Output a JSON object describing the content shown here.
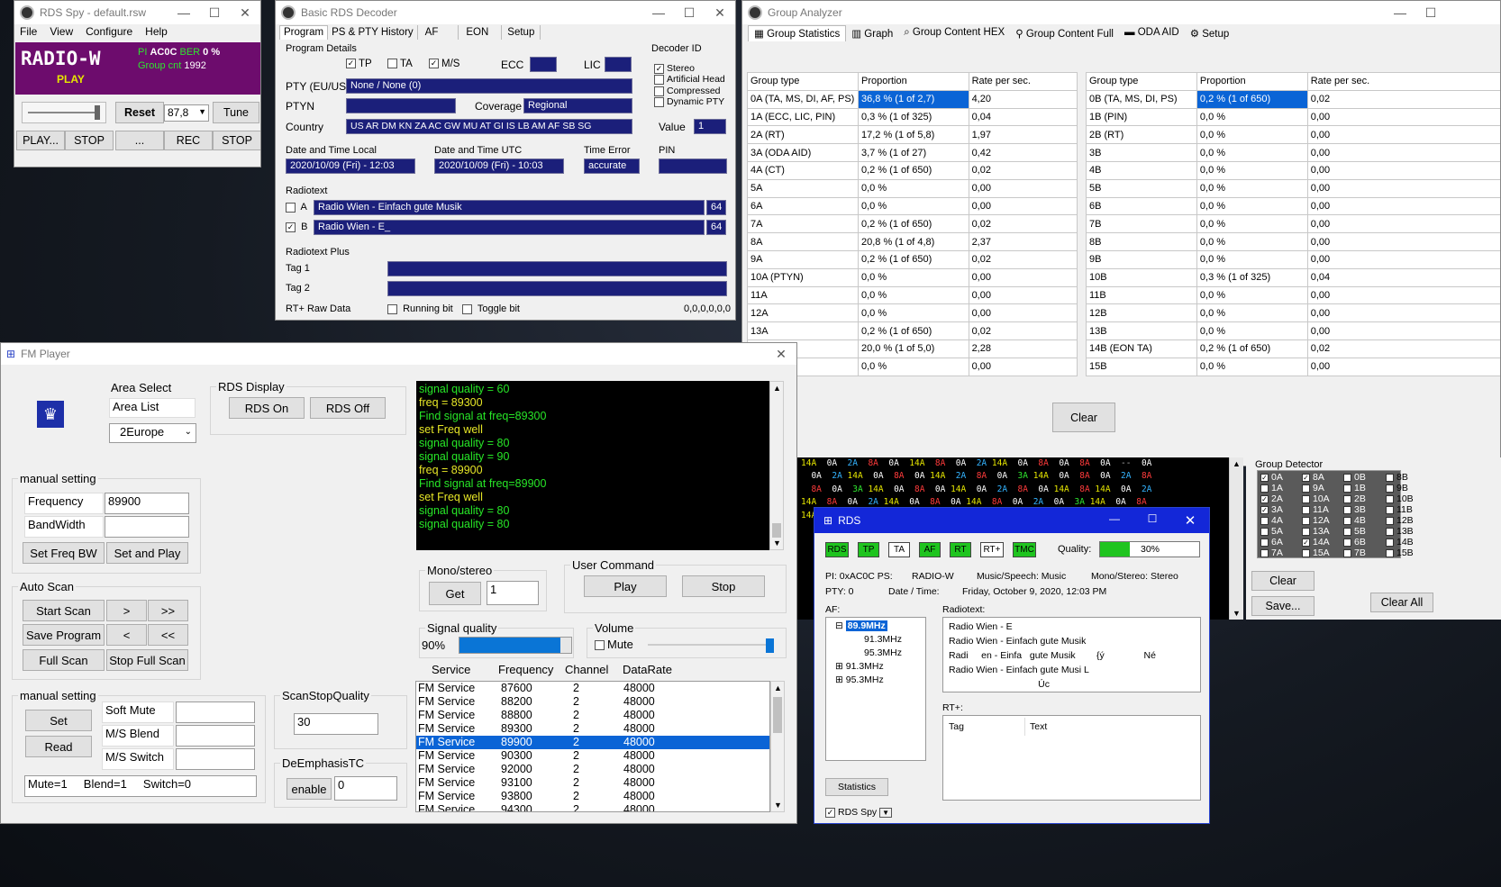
{
  "rds_spy": {
    "title": "RDS Spy - default.rsw",
    "menu": [
      "File",
      "View",
      "Configure",
      "Help"
    ],
    "station": "RADIO-W",
    "pi_label": "PI",
    "pi": "AC0C",
    "ber_label": "BER",
    "ber": "0 %",
    "group_cnt_label": "Group cnt",
    "group_cnt": "1992",
    "status": "PLAY",
    "reset": "Reset",
    "freq": "87,8",
    "tune": "Tune",
    "btns": [
      "PLAY...",
      "STOP",
      "...",
      "REC",
      "STOP"
    ]
  },
  "decoder": {
    "title": "Basic RDS Decoder",
    "tabs": [
      "Program",
      "PS & PTY History",
      "AF",
      "EON",
      "Setup"
    ],
    "program_details": "Program Details",
    "tp": "TP",
    "ta": "TA",
    "ms": "M/S",
    "ecc": "ECC",
    "lic": "LIC",
    "decoder_id": "Decoder ID",
    "stereo": "Stereo",
    "artificial_head": "Artificial Head",
    "compressed": "Compressed",
    "dynamic_pty": "Dynamic PTY",
    "value_label": "Value",
    "value": "1",
    "pty_label": "PTY (EU/US)",
    "pty": "None / None (0)",
    "ptyn_label": "PTYN",
    "coverage_label": "Coverage",
    "coverage": "Regional",
    "country_label": "Country",
    "country": "US AR DM KN ZA AC GW MU AT GI IS LB AM AF SB SG",
    "dt_local_label": "Date and Time Local",
    "dt_local": "2020/10/09 (Fri) - 12:03",
    "dt_utc_label": "Date and Time UTC",
    "dt_utc": "2020/10/09 (Fri) - 10:03",
    "time_error_label": "Time Error",
    "time_error": "accurate",
    "pin_label": "PIN",
    "radiotext_label": "Radiotext",
    "rt_a_label": "A",
    "rt_a": "Radio Wien - Einfach gute Musik",
    "rt_a_len": "64",
    "rt_b_label": "B",
    "rt_b": "Radio Wien - E_",
    "rt_b_len": "64",
    "rtplus_label": "Radiotext Plus",
    "tag1": "Tag 1",
    "tag2": "Tag 2",
    "rtplus_raw": "RT+ Raw Data",
    "running_bit": "Running bit",
    "toggle_bit": "Toggle bit",
    "raw_value": "0,0,0,0,0,0"
  },
  "analyzer": {
    "title": "Group Analyzer",
    "tabs": [
      "Group Statistics",
      "Graph",
      "Group Content HEX",
      "Group Content Full",
      "ODA AID",
      "Setup"
    ],
    "headers": [
      "Group type",
      "Proportion",
      "Rate per sec."
    ],
    "rows_a": [
      [
        "0A (TA, MS, DI, AF, PS)",
        "36,8 % (1 of 2,7)",
        "4,20"
      ],
      [
        "1A (ECC, LIC, PIN)",
        "0,3 % (1 of 325)",
        "0,04"
      ],
      [
        "2A (RT)",
        "17,2 % (1 of 5,8)",
        "1,97"
      ],
      [
        "3A (ODA AID)",
        "3,7 % (1 of 27)",
        "0,42"
      ],
      [
        "4A (CT)",
        "0,2 % (1 of 650)",
        "0,02"
      ],
      [
        "5A",
        "0,0 %",
        "0,00"
      ],
      [
        "6A",
        "0,0 %",
        "0,00"
      ],
      [
        "7A",
        "0,2 % (1 of 650)",
        "0,02"
      ],
      [
        "8A",
        "20,8 % (1 of 4,8)",
        "2,37"
      ],
      [
        "9A",
        "0,2 % (1 of 650)",
        "0,02"
      ],
      [
        "10A (PTYN)",
        "0,0 %",
        "0,00"
      ],
      [
        "11A",
        "0,0 %",
        "0,00"
      ],
      [
        "12A",
        "0,0 %",
        "0,00"
      ],
      [
        "13A",
        "0,2 % (1 of 650)",
        "0,02"
      ],
      [
        "",
        "20,0 % (1 of 5,0)",
        "2,28"
      ],
      [
        "",
        "0,0 %",
        "0,00"
      ]
    ],
    "rows_b": [
      [
        "0B (TA, MS, DI, PS)",
        "0,2 % (1 of 650)",
        "0,02"
      ],
      [
        "1B (PIN)",
        "0,0 %",
        "0,00"
      ],
      [
        "2B (RT)",
        "0,0 %",
        "0,00"
      ],
      [
        "3B",
        "0,0 %",
        "0,00"
      ],
      [
        "4B",
        "0,0 %",
        "0,00"
      ],
      [
        "5B",
        "0,0 %",
        "0,00"
      ],
      [
        "6B",
        "0,0 %",
        "0,00"
      ],
      [
        "7B",
        "0,0 %",
        "0,00"
      ],
      [
        "8B",
        "0,0 %",
        "0,00"
      ],
      [
        "9B",
        "0,0 %",
        "0,00"
      ],
      [
        "10B",
        "0,3 % (1 of 325)",
        "0,04"
      ],
      [
        "11B",
        "0,0 %",
        "0,00"
      ],
      [
        "12B",
        "0,0 %",
        "0,00"
      ],
      [
        "13B",
        "0,0 %",
        "0,00"
      ],
      [
        "14B (EON TA)",
        "0,2 % (1 of 650)",
        "0,02"
      ],
      [
        "15B",
        "0,0 %",
        "0,00"
      ]
    ],
    "clear": "Clear"
  },
  "hex_stream": [
    "14A  0A  2A  8A  0A  14A  8A  0A  2A 14A  0A  8A  0A  8A  0A  --  0A",
    "  0A  2A 14A  0A  8A  0A 14A  2A  8A  0A  3A 14A  0A  8A  0A  2A  8A",
    "  8A  0A  3A 14A  0A  8A  0A 14A  0A  2A  8A  0A 14A  8A 14A  0A  2A",
    "14A  8A  0A  2A 14A  0A  8A  0A 14A  8A  0A  2A  0A  3A 14A  0A  8A",
    "14A  0A  8A  0A  2A  8A  0A 14A  0A  8A  2A  0A 14A  0A  8A  0A  2A"
  ],
  "group_detector": {
    "title": "Group Detector",
    "items": [
      [
        "0A",
        "8A",
        "0B",
        "8B"
      ],
      [
        "1A",
        "9A",
        "1B",
        "9B"
      ],
      [
        "2A",
        "10A",
        "2B",
        "10B"
      ],
      [
        "3A",
        "11A",
        "3B",
        "11B"
      ],
      [
        "4A",
        "12A",
        "4B",
        "12B"
      ],
      [
        "5A",
        "13A",
        "5B",
        "13B"
      ],
      [
        "6A",
        "14A",
        "6B",
        "14B"
      ],
      [
        "7A",
        "15A",
        "7B",
        "15B"
      ]
    ],
    "clear": "Clear",
    "save": "Save...",
    "clear_all": "Clear All"
  },
  "fm": {
    "title": "FM Player",
    "area_select": "Area Select",
    "area_list": "Area List",
    "area_value": "2Europe",
    "rds_display": "RDS Display",
    "rds_on": "RDS On",
    "rds_off": "RDS Off",
    "manual_setting": "manual setting",
    "frequency_label": "Frequency",
    "frequency": "89900",
    "bandwidth_label": "BandWidth",
    "set_freq_bw": "Set Freq BW",
    "set_and_play": "Set and Play",
    "auto_scan": "Auto Scan",
    "start_scan": "Start Scan",
    "next": ">",
    "next_fast": ">>",
    "save_program": "Save Program",
    "prev": "<",
    "prev_fast": "<<",
    "full_scan": "Full Scan",
    "stop_full_scan": "Stop Full Scan",
    "manual_setting2": "manual setting",
    "set": "Set",
    "read": "Read",
    "soft_mute": "Soft Mute",
    "ms_blend": "M/S Blend",
    "ms_switch": "M/S Switch",
    "status_line": "Mute=1     Blend=1     Switch=0",
    "scan_stop_quality": "ScanStopQuality",
    "scan_stop_value": "30",
    "deemphasis": "DeEmphasisTC",
    "enable": "enable",
    "deemphasis_value": "0",
    "log": [
      [
        "signal quality = 60",
        "#27e627"
      ],
      [
        "freq = 89300",
        "#e6e627"
      ],
      [
        "Find signal at freq=89300",
        "#27e627"
      ],
      [
        "set Freq well",
        "#e6e627"
      ],
      [
        "signal quality = 80",
        "#27e627"
      ],
      [
        "signal quality = 90",
        "#27e627"
      ],
      [
        "freq = 89900",
        "#e6e627"
      ],
      [
        "Find signal at freq=89900",
        "#27e627"
      ],
      [
        "set Freq well",
        "#e6e627"
      ],
      [
        "signal quality = 80",
        "#27e627"
      ],
      [
        "signal quality = 80",
        "#27e627"
      ]
    ],
    "mono_stereo": "Mono/stereo",
    "get": "Get",
    "mono_value": "1",
    "user_command": "User Command",
    "play": "Play",
    "stop": "Stop",
    "signal_quality": "Signal quality",
    "sq_value": "90%",
    "sq_fraction": 0.9,
    "volume": "Volume",
    "mute": "Mute",
    "volume_fraction": 1.0,
    "svc_headers": [
      "Service",
      "Frequency",
      "Channel",
      "DataRate"
    ],
    "services": [
      [
        "FM Service",
        "87600",
        "2",
        "48000"
      ],
      [
        "FM Service",
        "88200",
        "2",
        "48000"
      ],
      [
        "FM Service",
        "88800",
        "2",
        "48000"
      ],
      [
        "FM Service",
        "89300",
        "2",
        "48000"
      ],
      [
        "FM Service",
        "89900",
        "2",
        "48000"
      ],
      [
        "FM Service",
        "90300",
        "2",
        "48000"
      ],
      [
        "FM Service",
        "92000",
        "2",
        "48000"
      ],
      [
        "FM Service",
        "93100",
        "2",
        "48000"
      ],
      [
        "FM Service",
        "93800",
        "2",
        "48000"
      ],
      [
        "FM Service",
        "94300",
        "2",
        "48000"
      ]
    ],
    "selected_service": 4
  },
  "rds": {
    "title": "RDS",
    "flags": [
      "RDS",
      "TP",
      "TA",
      "AF",
      "RT",
      "RT+",
      "TMC"
    ],
    "flag_on": [
      true,
      true,
      false,
      true,
      true,
      false,
      true
    ],
    "quality_label": "Quality:",
    "quality": "30%",
    "quality_fraction": 0.3,
    "pi": "PI:  0xAC0C  PS:",
    "ps": "RADIO-W",
    "music_speech": "Music/Speech:  Music",
    "mono_stereo": "Mono/Stereo:  Stereo",
    "pty": "PTY:  0",
    "date_time": "Date / Time:",
    "date_time_value": "Friday, October 9, 2020, 12:03 PM",
    "af_label": "AF:",
    "af_tree": [
      "89.9MHz",
      "91.3MHz",
      "95.3MHz",
      "91.3MHz",
      "95.3MHz"
    ],
    "radiotext_label": "Radiotext:",
    "radiotext": [
      "Radio Wien - E",
      "Radio Wien - Einfach gute Musik",
      "Radi     en - Einfa   gute Musik        {ý               Né",
      "Radio Wien - Einfach gute Musi L",
      "                                  Úc"
    ],
    "rtplus_label": "RT+:",
    "rtplus_tag": "Tag",
    "rtplus_text": "Text",
    "statistics": "Statistics",
    "rds_spy": "RDS Spy"
  }
}
